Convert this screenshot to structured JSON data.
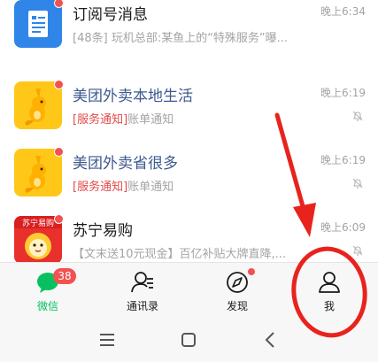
{
  "chats": [
    {
      "title": "订阅号消息",
      "time": "晚上6:34",
      "preview": "[48条] 玩机总部:某鱼上的“特殊服务”曝...",
      "avatar": "subscription-doc-icon",
      "unread": true,
      "muted": false
    },
    {
      "title": "美团外卖本地生活",
      "time": "晚上6:19",
      "preview_tag": "[服务通知]",
      "preview": "账单通知",
      "avatar": "meituan-kangaroo-logo",
      "unread": true,
      "muted": true
    },
    {
      "title": "美团外卖省很多",
      "time": "晚上6:19",
      "preview_tag": "[服务通知]",
      "preview": "账单通知",
      "avatar": "meituan-kangaroo-logo",
      "unread": true,
      "muted": true
    },
    {
      "title": "苏宁易购",
      "time": "晚上6:09",
      "preview": "【文末送10元现金】百亿补贴大牌直降,...",
      "avatar": "suning-lion-logo",
      "avatar_text": "苏宁易购",
      "unread": true,
      "muted": true
    }
  ],
  "tabbar": {
    "tabs": [
      {
        "label": "微信",
        "icon": "chat-bubble-icon",
        "badge": "38",
        "active": true
      },
      {
        "label": "通讯录",
        "icon": "contacts-icon"
      },
      {
        "label": "发现",
        "icon": "compass-icon",
        "dot": true
      },
      {
        "label": "我",
        "icon": "person-icon"
      }
    ]
  },
  "navbar": {
    "buttons": [
      "menu-icon",
      "home-icon",
      "back-icon"
    ]
  },
  "colors": {
    "accent_green": "#07c160",
    "badge_red": "#f25151",
    "annotation_red": "#e8231d",
    "official_blue": "#3d5a8f"
  }
}
